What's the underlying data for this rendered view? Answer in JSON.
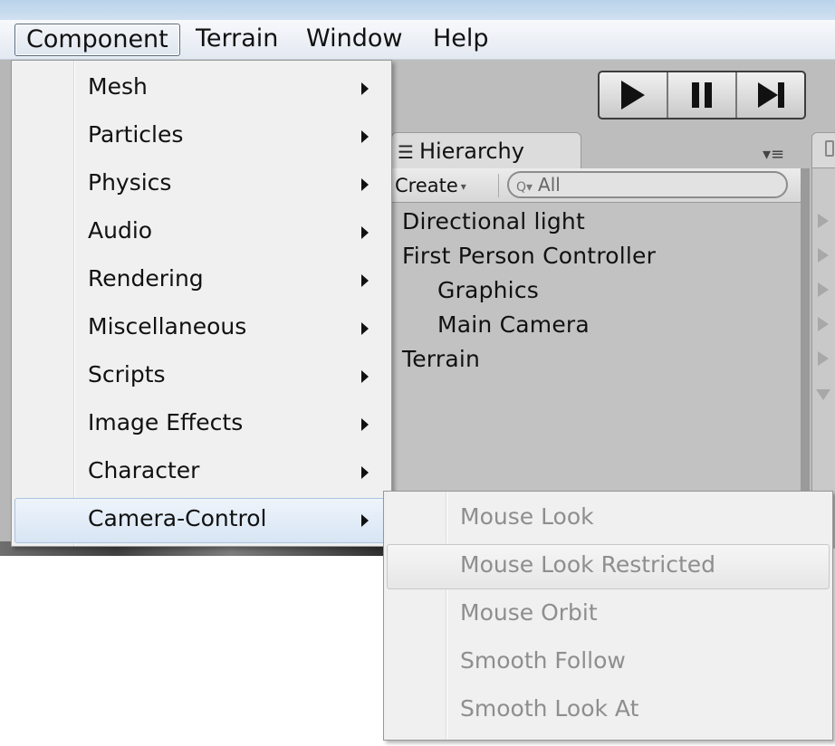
{
  "menubar": {
    "items": [
      {
        "label": "Component",
        "active": true
      },
      {
        "label": "Terrain"
      },
      {
        "label": "Window"
      },
      {
        "label": "Help"
      }
    ]
  },
  "component_menu": {
    "items": [
      {
        "label": "Mesh",
        "has_submenu": true
      },
      {
        "label": "Particles",
        "has_submenu": true
      },
      {
        "label": "Physics",
        "has_submenu": true
      },
      {
        "label": "Audio",
        "has_submenu": true
      },
      {
        "label": "Rendering",
        "has_submenu": true
      },
      {
        "label": "Miscellaneous",
        "has_submenu": true
      },
      {
        "label": "Scripts",
        "has_submenu": true
      },
      {
        "label": "Image Effects",
        "has_submenu": true
      },
      {
        "label": "Character",
        "has_submenu": true
      },
      {
        "label": "Camera-Control",
        "has_submenu": true,
        "highlighted": true
      }
    ]
  },
  "camera_control_submenu": {
    "items": [
      {
        "label": "Mouse Look",
        "disabled": true
      },
      {
        "label": "Mouse Look Restricted",
        "disabled": true,
        "hovered": true
      },
      {
        "label": "Mouse Orbit",
        "disabled": true
      },
      {
        "label": "Smooth Follow",
        "disabled": true
      },
      {
        "label": "Smooth Look At",
        "disabled": true
      }
    ]
  },
  "toolbar": {
    "play_icon": "play-icon",
    "pause_icon": "pause-icon",
    "step_icon": "step-icon"
  },
  "hierarchy": {
    "tab_label": "Hierarchy",
    "create_label": "Create",
    "search_placeholder": "All",
    "items": [
      {
        "label": "Directional light",
        "indent": 0
      },
      {
        "label": "First Person Controller",
        "indent": 0
      },
      {
        "label": "Graphics",
        "indent": 1
      },
      {
        "label": "Main Camera",
        "indent": 1
      },
      {
        "label": "Terrain",
        "indent": 0
      }
    ]
  },
  "colors": {
    "menu_highlight": "#d7e5f4",
    "disabled_text": "#8e8e8e",
    "editor_bg": "#bdbdbd"
  }
}
